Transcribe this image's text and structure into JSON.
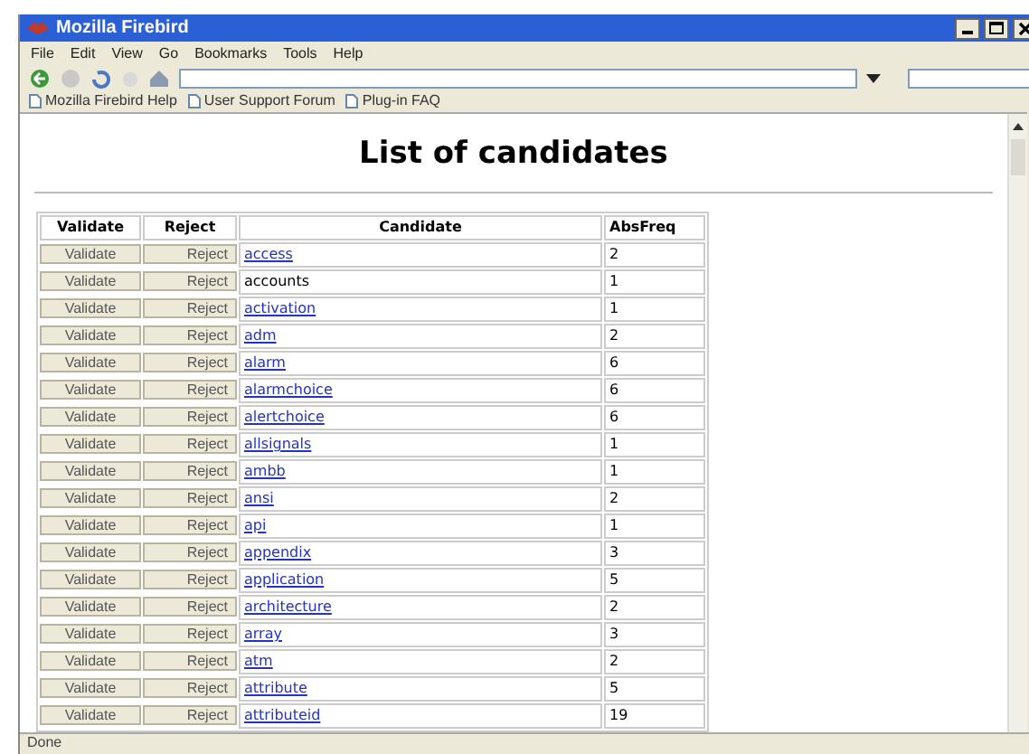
{
  "window": {
    "title": "Mozilla Firebird"
  },
  "menu": [
    "File",
    "Edit",
    "View",
    "Go",
    "Bookmarks",
    "Tools",
    "Help"
  ],
  "bookmarks": [
    "Mozilla Firebird Help",
    "User Support Forum",
    "Plug-in FAQ"
  ],
  "page": {
    "heading": "List of candidates"
  },
  "table": {
    "columns": [
      "Validate",
      "Reject",
      "Candidate",
      "AbsFreq"
    ],
    "rows": [
      {
        "validate": "Validate",
        "reject": "Reject",
        "candidate": "access",
        "linked": true,
        "freq": "2"
      },
      {
        "validate": "Validate",
        "reject": "Reject",
        "candidate": "accounts",
        "linked": false,
        "freq": "1"
      },
      {
        "validate": "Validate",
        "reject": "Reject",
        "candidate": "activation",
        "linked": true,
        "freq": "1"
      },
      {
        "validate": "Validate",
        "reject": "Reject",
        "candidate": "adm",
        "linked": true,
        "freq": "2"
      },
      {
        "validate": "Validate",
        "reject": "Reject",
        "candidate": "alarm",
        "linked": true,
        "freq": "6"
      },
      {
        "validate": "Validate",
        "reject": "Reject",
        "candidate": "alarmchoice",
        "linked": true,
        "freq": "6"
      },
      {
        "validate": "Validate",
        "reject": "Reject",
        "candidate": "alertchoice",
        "linked": true,
        "freq": "6"
      },
      {
        "validate": "Validate",
        "reject": "Reject",
        "candidate": "allsignals",
        "linked": true,
        "freq": "1"
      },
      {
        "validate": "Validate",
        "reject": "Reject",
        "candidate": "ambb",
        "linked": true,
        "freq": "1"
      },
      {
        "validate": "Validate",
        "reject": "Reject",
        "candidate": "ansi",
        "linked": true,
        "freq": "2"
      },
      {
        "validate": "Validate",
        "reject": "Reject",
        "candidate": "api",
        "linked": true,
        "freq": "1"
      },
      {
        "validate": "Validate",
        "reject": "Reject",
        "candidate": "appendix",
        "linked": true,
        "freq": "3"
      },
      {
        "validate": "Validate",
        "reject": "Reject",
        "candidate": "application",
        "linked": true,
        "freq": "5"
      },
      {
        "validate": "Validate",
        "reject": "Reject",
        "candidate": "architecture",
        "linked": true,
        "freq": "2"
      },
      {
        "validate": "Validate",
        "reject": "Reject",
        "candidate": "array",
        "linked": true,
        "freq": "3"
      },
      {
        "validate": "Validate",
        "reject": "Reject",
        "candidate": "atm",
        "linked": true,
        "freq": "2"
      },
      {
        "validate": "Validate",
        "reject": "Reject",
        "candidate": "attribute",
        "linked": true,
        "freq": "5"
      },
      {
        "validate": "Validate",
        "reject": "Reject",
        "candidate": "attributeid",
        "linked": true,
        "freq": "19"
      }
    ]
  },
  "status_bar": "Done"
}
